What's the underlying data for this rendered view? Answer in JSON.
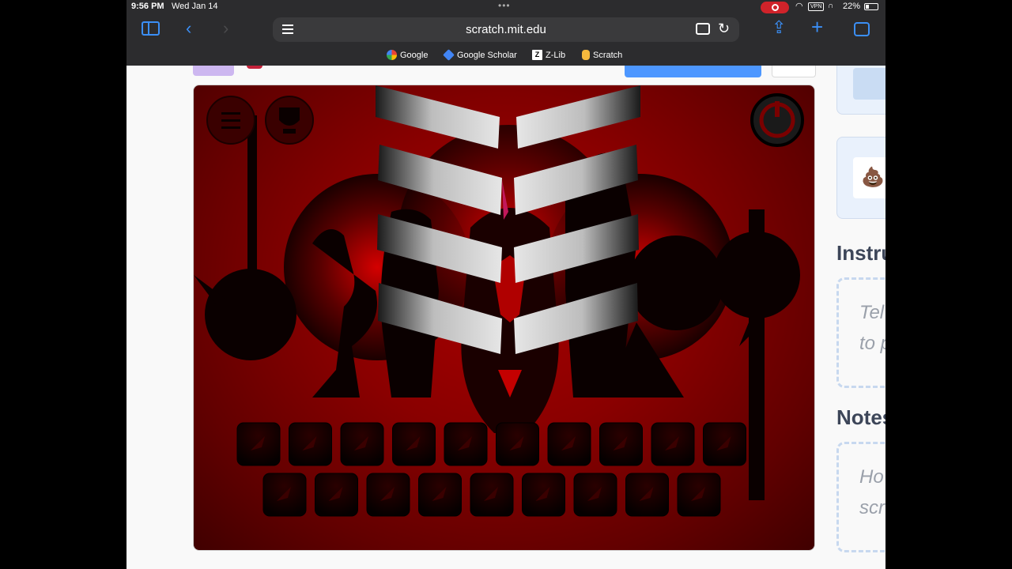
{
  "status_bar": {
    "time": "9:56 PM",
    "date": "Wed Jan 14",
    "vpn": "VPN",
    "battery": "22%"
  },
  "browser": {
    "url": "scratch.mit.edu",
    "bookmarks": [
      "Google",
      "Google Scholar",
      "Z-Lib",
      "Scratch"
    ],
    "bookmark_icons": {
      "zlib": "Z"
    },
    "icons": [
      "sidebar-icon",
      "back-icon",
      "forward-icon",
      "page-menu-icon",
      "extension-icon",
      "reload-icon",
      "share-icon",
      "new-tab-icon",
      "tabs-icon"
    ]
  },
  "page": {
    "instructions_title": "Instru",
    "instructions_text": [
      "Tel",
      "to p"
    ],
    "notes_title": "Notes",
    "notes_text": [
      "Ho",
      "scr"
    ]
  },
  "stage": {
    "controls": [
      "menu-icon",
      "trophy-icon",
      "power-icon"
    ],
    "palette_rows": [
      10,
      9
    ],
    "accent": "#a80000"
  }
}
